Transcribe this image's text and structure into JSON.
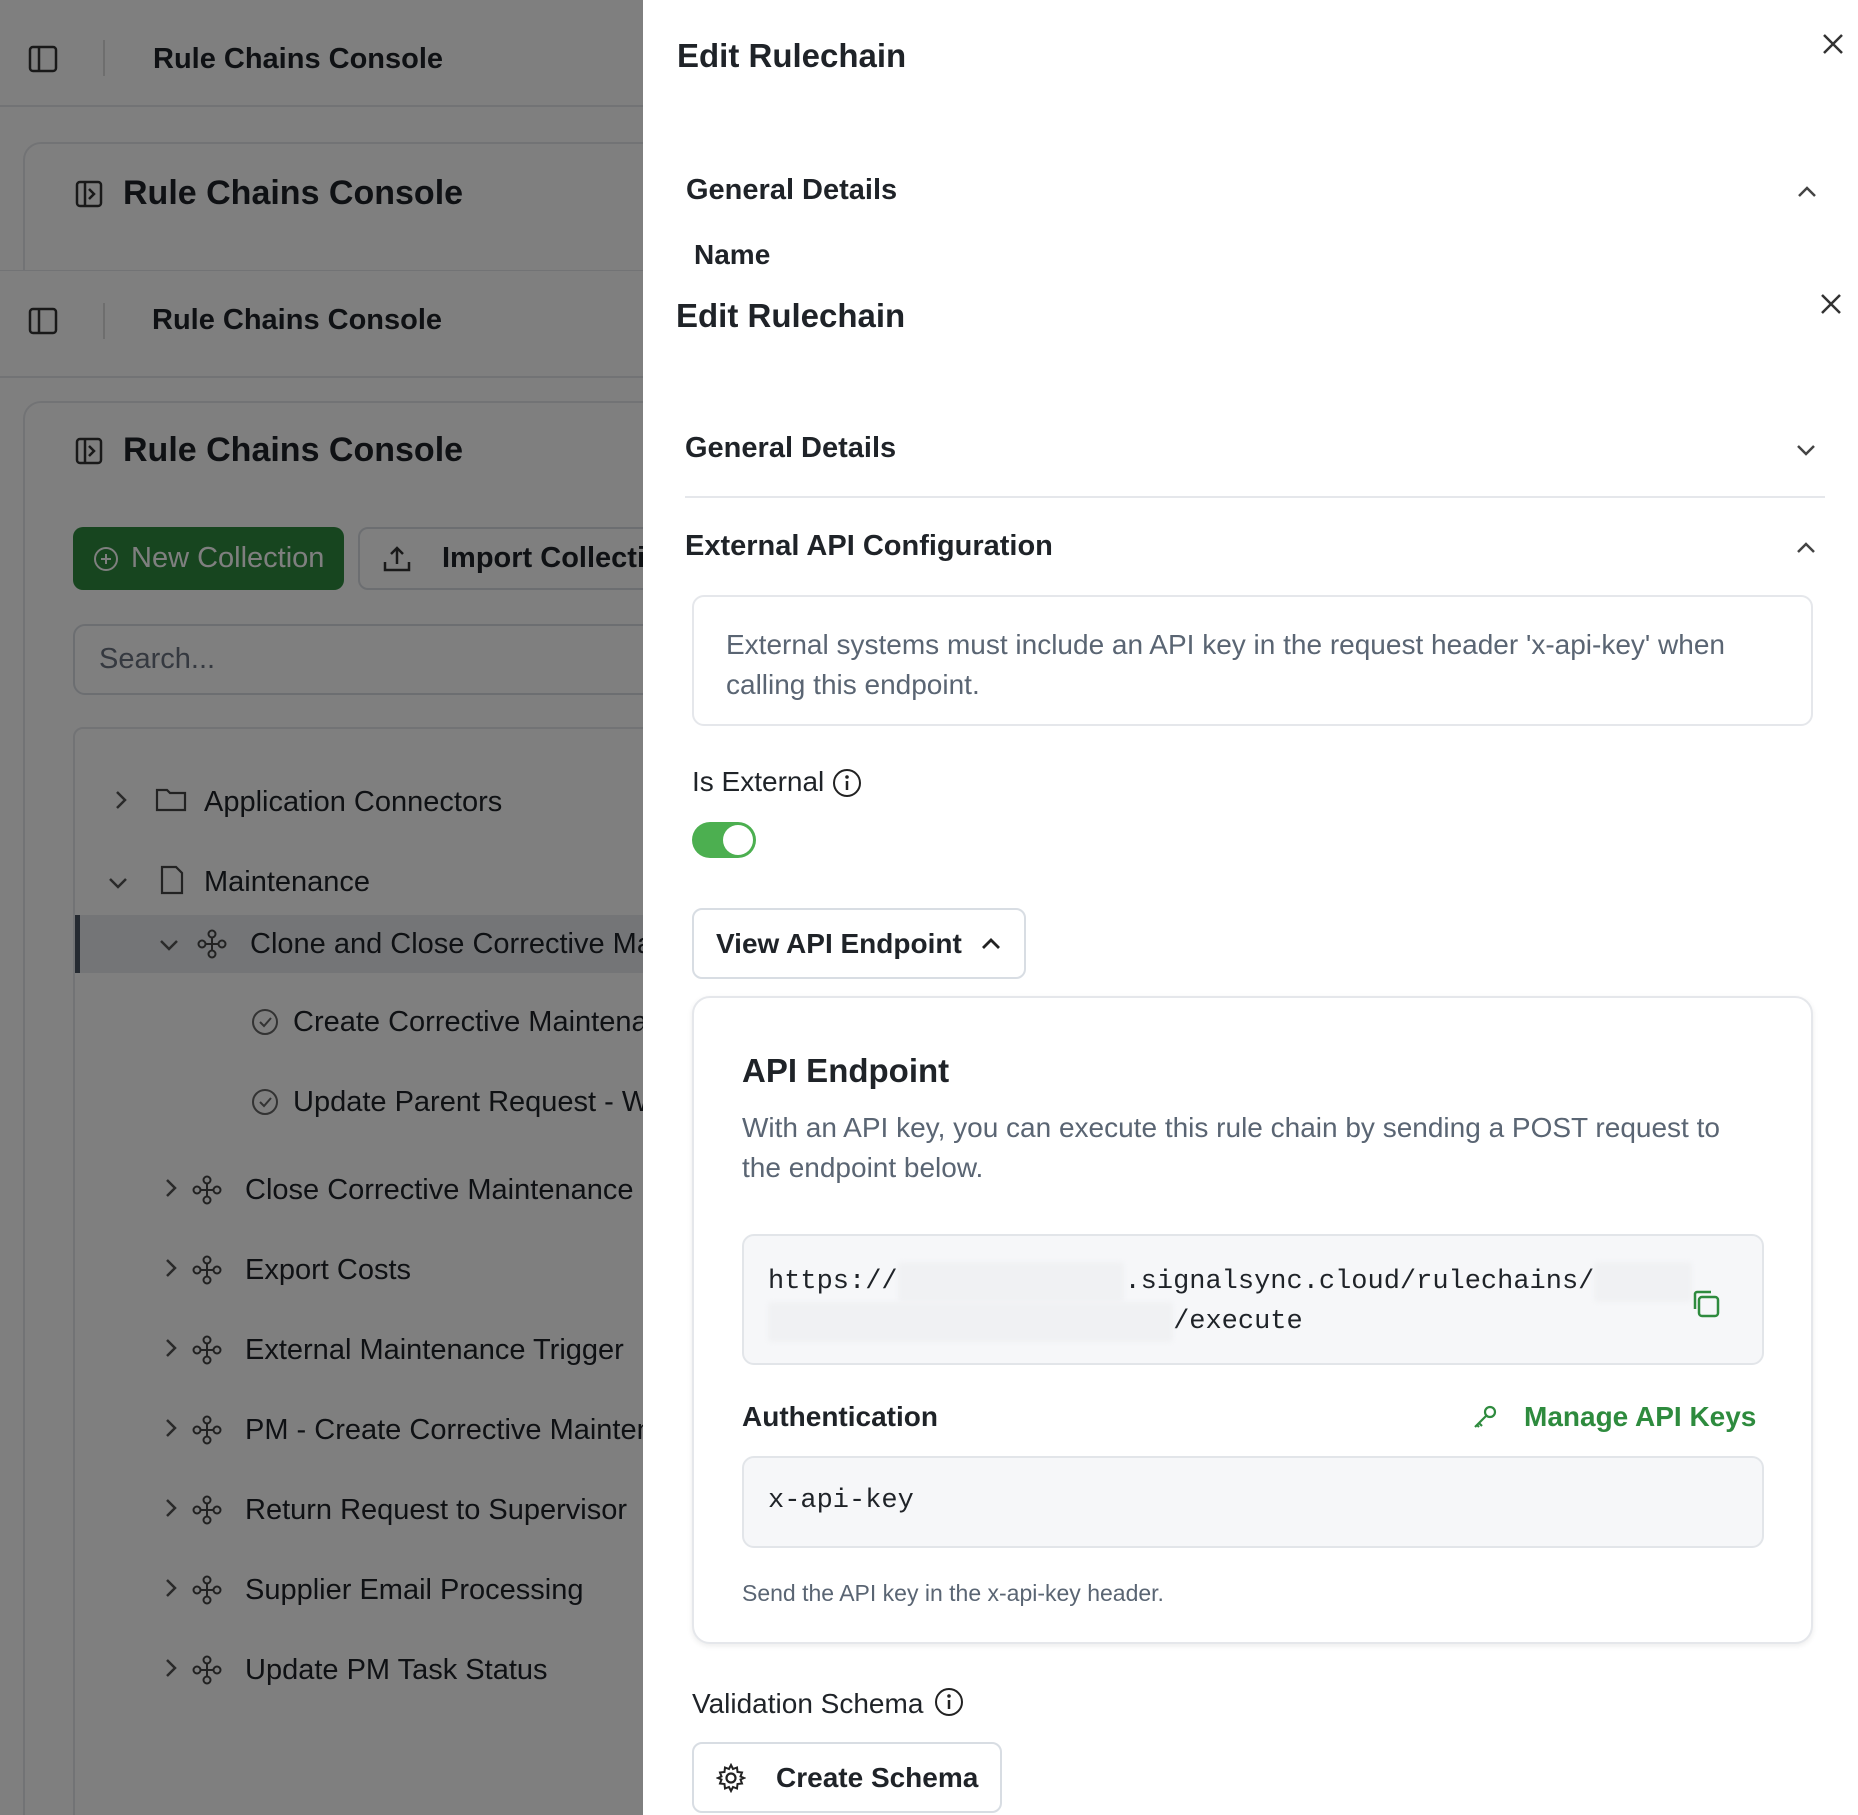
{
  "app": {
    "title": "Rule Chains Console"
  },
  "console": {
    "title": "Rule Chains Console",
    "new_collection": "New Collection",
    "import_collection": "Import Collectio",
    "search_placeholder": "Search..."
  },
  "tree": {
    "application_connectors": "Application Connectors",
    "maintenance": "Maintenance",
    "clone_close": "Clone and Close Corrective Mai",
    "create_corrective": "Create Corrective Maintenar",
    "update_parent": "Update Parent Request - Wo",
    "close_corrective": "Close Corrective Maintenance R",
    "export_costs": "Export Costs",
    "external_trigger": "External Maintenance Trigger",
    "pm_create": "PM - Create Corrective Mainten",
    "return_request": "Return Request to Supervisor",
    "supplier_email": "Supplier Email Processing",
    "update_pm_task": "Update PM Task Status"
  },
  "panel": {
    "title": "Edit Rulechain",
    "general_details": "General Details",
    "name_label": "Name",
    "external_api_config": "External API Configuration",
    "info_text": "External systems must include an API key in the request header 'x-api-key' when calling this endpoint.",
    "is_external": "Is External",
    "is_external_on": true,
    "view_endpoint": "View API Endpoint",
    "api_endpoint_title": "API Endpoint",
    "api_endpoint_desc": "With an API key, you can execute this rule chain by sending a POST request to the endpoint below.",
    "url_prefix": "https://",
    "url_domain": ".signalsync.cloud/rulechains/",
    "url_suffix": "/execute",
    "authentication": "Authentication",
    "manage_keys": "Manage API Keys",
    "header_name": "x-api-key",
    "auth_hint": "Send the API key in the x-api-key header.",
    "validation_schema": "Validation Schema",
    "create_schema": "Create Schema"
  },
  "colors": {
    "accent": "#2e8b3e",
    "toggle": "#4caf50"
  }
}
